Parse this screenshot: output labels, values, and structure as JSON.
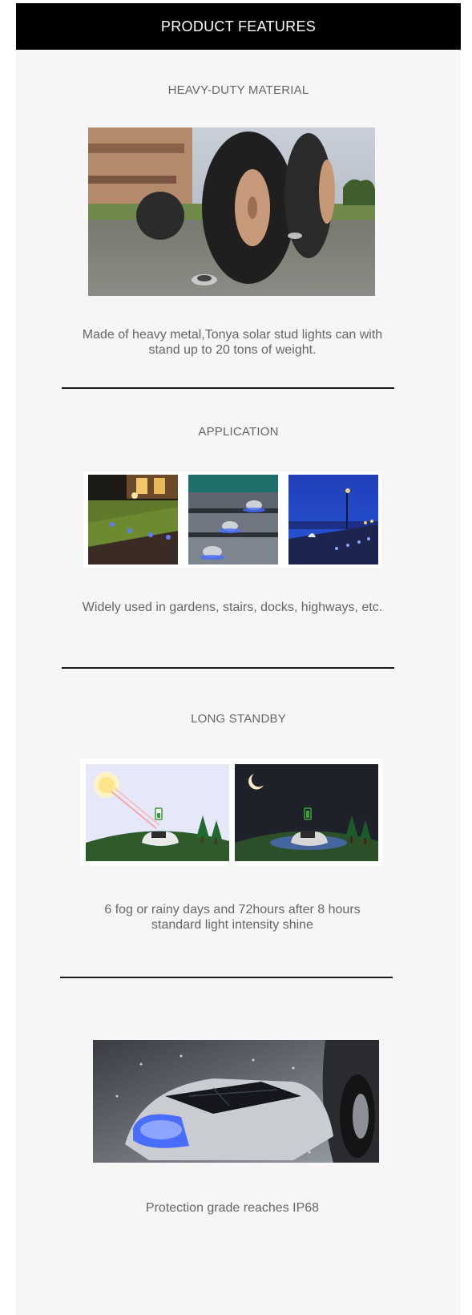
{
  "header": {
    "title": "PRODUCT FEATURES"
  },
  "sections": [
    {
      "title": "HEAVY-DUTY MATERIAL",
      "description": "Made of heavy metal,Tonya solar stud lights can with stand up to 20 tons of weight."
    },
    {
      "title": "APPLICATION",
      "description": "Widely used in gardens, stairs, docks, highways, etc."
    },
    {
      "title": "LONG STANDBY",
      "description": "6 fog or rainy days and 72hours after 8 hours standard light intensity shine"
    },
    {
      "title": "",
      "description": "Protection grade reaches IP68"
    }
  ],
  "colors": {
    "header_bg": "#000000",
    "panel_bg": "#f6f6f6",
    "text": "#666666",
    "led_blue": "#4a6dff"
  }
}
